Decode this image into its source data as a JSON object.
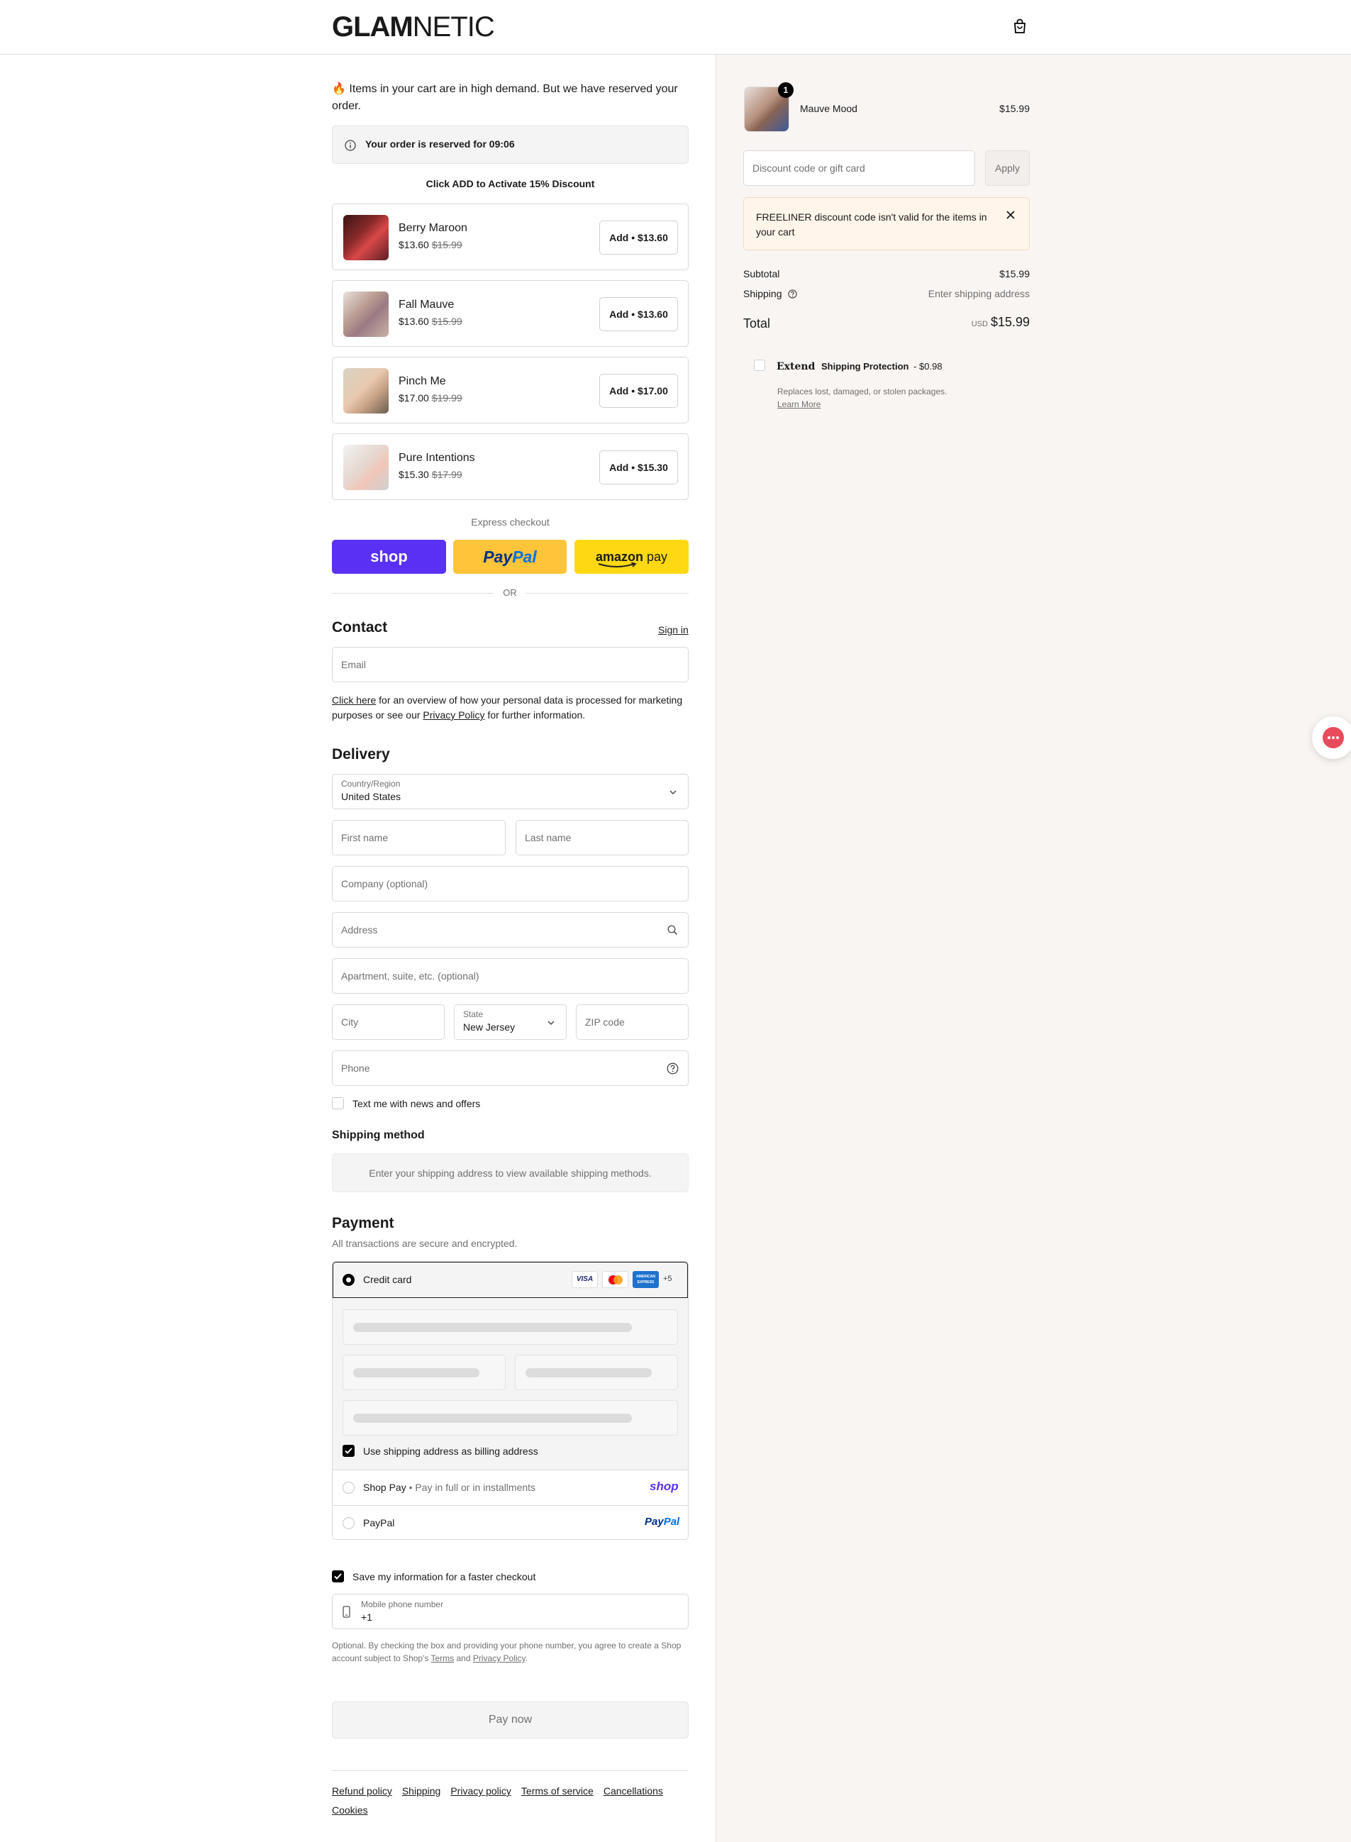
{
  "header": {
    "logo_bold": "GLAM",
    "logo_light": "NETIC",
    "cart_icon": "shopping-bag-icon"
  },
  "demand": {
    "emoji": "🔥",
    "text": "Items in your cart are in high demand. But we have reserved your order."
  },
  "reserve": {
    "text": "Your order is reserved for 09:06",
    "icon": "info-icon"
  },
  "upsell": {
    "heading": "Click ADD to Activate 15% Discount",
    "items": [
      {
        "name": "Berry Maroon",
        "price": "$13.60",
        "compare": "$15.99",
        "button": "Add • $13.60"
      },
      {
        "name": "Fall Mauve",
        "price": "$13.60",
        "compare": "$15.99",
        "button": "Add • $13.60"
      },
      {
        "name": "Pinch Me",
        "price": "$17.00",
        "compare": "$19.99",
        "button": "Add • $17.00"
      },
      {
        "name": "Pure Intentions",
        "price": "$15.30",
        "compare": "$17.99",
        "button": "Add • $15.30"
      }
    ]
  },
  "express": {
    "label": "Express checkout",
    "shop": "shop",
    "paypal_a": "Pay",
    "paypal_b": "Pal",
    "amazon": "amazon",
    "amazon_pay": "pay",
    "or": "OR"
  },
  "contact": {
    "title": "Contact",
    "sign_in": "Sign in",
    "email_placeholder": "Email",
    "privacy_link": "Click here",
    "privacy_mid": " for an overview of how your personal data is processed for marketing purposes or see our ",
    "privacy_policy": "Privacy Policy",
    "privacy_end": " for further information."
  },
  "delivery": {
    "title": "Delivery",
    "country_label": "Country/Region",
    "country_value": "United States",
    "first_name": "First name",
    "last_name": "Last name",
    "company": "Company (optional)",
    "address": "Address",
    "apartment": "Apartment, suite, etc. (optional)",
    "city": "City",
    "state_label": "State",
    "state_value": "New Jersey",
    "zip": "ZIP code",
    "phone": "Phone",
    "text_me": "Text me with news and offers"
  },
  "shipping_method": {
    "title": "Shipping method",
    "info": "Enter your shipping address to view available shipping methods."
  },
  "payment": {
    "title": "Payment",
    "subtitle": "All transactions are secure and encrypted.",
    "credit_card": "Credit card",
    "more_cards": "+5",
    "visa": "VISA",
    "amex": "AMERICAN EXPRESS",
    "billing": "Use shipping address as billing address",
    "shop_pay": "Shop Pay",
    "shop_pay_sub": "Pay in full or in installments",
    "shop_logo": "shop",
    "paypal": "PayPal",
    "paypal_logo_a": "Pay",
    "paypal_logo_b": "Pal"
  },
  "save_info": {
    "label": "Save my information for a faster checkout",
    "mobile_label": "Mobile phone number",
    "mobile_value": "+1",
    "legal_a": "Optional. By checking the box and providing your phone number, you agree to create a Shop account subject to Shop's ",
    "terms": "Terms",
    "legal_and": " and ",
    "privacy": "Privacy Policy",
    "legal_end": "."
  },
  "pay_now": "Pay now",
  "footer": [
    "Refund policy",
    "Shipping",
    "Privacy policy",
    "Terms of service",
    "Cancellations",
    "Cookies"
  ],
  "summary": {
    "item_name": "Mauve Mood",
    "item_price": "$15.99",
    "item_qty": "1",
    "discount_placeholder": "Discount code or gift card",
    "apply": "Apply",
    "discount_error": "FREELINER discount code isn't valid for the items in your cart",
    "subtotal_label": "Subtotal",
    "subtotal": "$15.99",
    "shipping_label": "Shipping",
    "shipping_value": "Enter shipping address",
    "total_label": "Total",
    "currency": "USD",
    "total": "$15.99",
    "extend_brand": "Extend",
    "extend_label": "Shipping Protection",
    "extend_price": "- $0.98",
    "extend_desc": "Replaces lost, damaged, or stolen packages.",
    "learn_more": "Learn More"
  },
  "colors": {
    "shop_purple": "#5a31f4",
    "paypal_yellow": "#ffc439",
    "amazon_yellow": "#ffd814",
    "error_bg": "#fff5ea",
    "side_bg": "#f9f5f2",
    "chat_red": "#e84b5c"
  }
}
